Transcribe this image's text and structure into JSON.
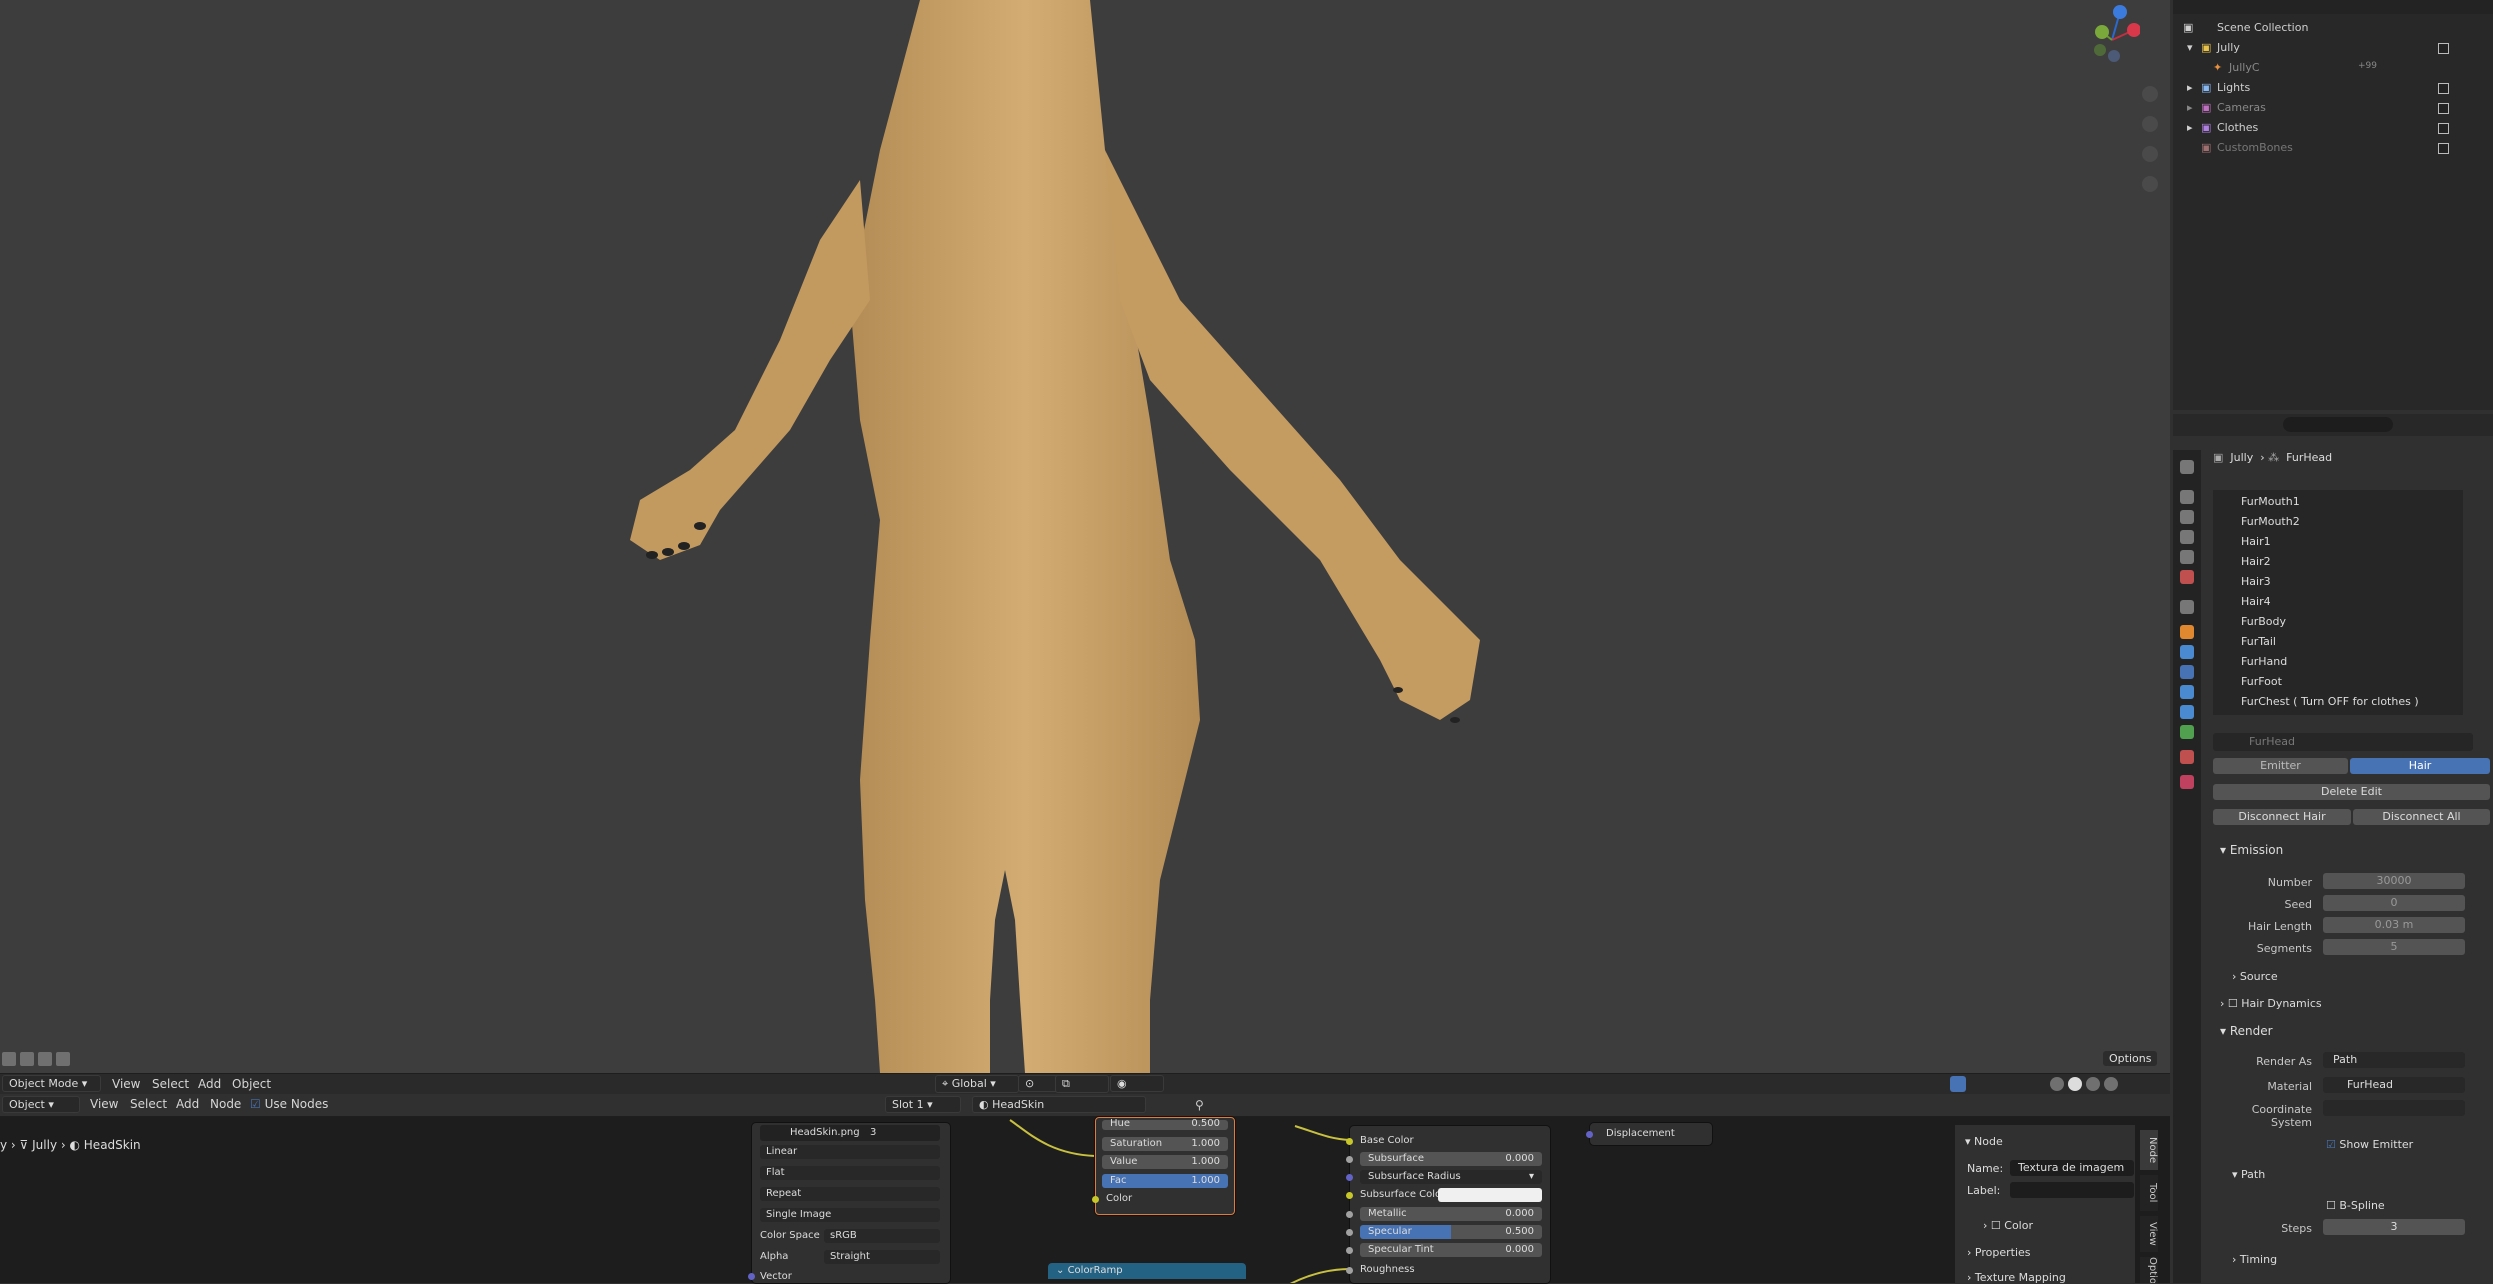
{
  "viewport": {
    "header": {
      "mode": "Object Mode",
      "menus": [
        "View",
        "Select",
        "Add",
        "Object"
      ],
      "orientation": "Global",
      "options": "Options"
    },
    "gizmo": {
      "axis_x": "X",
      "axis_y": "Y",
      "axis_z": "Z"
    }
  },
  "outliner": {
    "title": "Scene Collection",
    "items": [
      {
        "name": "Jully"
      },
      {
        "name": "JullyC",
        "badge": "+99"
      },
      {
        "name": "Lights"
      },
      {
        "name": "Cameras"
      },
      {
        "name": "Clothes"
      },
      {
        "name": "CustomBones"
      }
    ]
  },
  "properties": {
    "breadcrumb": {
      "object": "Jully",
      "system": "FurHead"
    },
    "particle_systems": [
      "FurMouth1",
      "FurMouth2",
      "Hair1",
      "Hair2",
      "Hair3",
      "Hair4",
      "FurBody",
      "FurTail",
      "FurHand",
      "FurFoot",
      "FurChest ( Turn OFF for clothes )"
    ],
    "settings_name": "FurHead",
    "type_tabs": {
      "emitter": "Emitter",
      "hair": "Hair"
    },
    "delete_edit": "Delete Edit",
    "disconnect_hair": "Disconnect Hair",
    "disconnect_all": "Disconnect All",
    "emission": {
      "title": "Emission",
      "number_label": "Number",
      "number": "30000",
      "seed_label": "Seed",
      "seed": "0",
      "hair_length_label": "Hair Length",
      "hair_length": "0.03 m",
      "segments_label": "Segments",
      "segments": "5"
    },
    "source": "Source",
    "hair_dynamics": "Hair Dynamics",
    "render": {
      "title": "Render",
      "render_as_label": "Render As",
      "render_as": "Path",
      "material_label": "Material",
      "material": "FurHead",
      "coord_label": "Coordinate System",
      "show_emitter": "Show Emitter",
      "path": "Path",
      "bspline": "B-Spline",
      "steps_label": "Steps",
      "steps": "3",
      "timing": "Timing"
    }
  },
  "node_editor": {
    "header": {
      "object": "Object",
      "menus": [
        "View",
        "Select",
        "Add",
        "Node"
      ],
      "use_nodes": "Use Nodes",
      "slot": "Slot 1",
      "material": "HeadSkin"
    },
    "breadcrumb": {
      "prefix": "y",
      "object": "Jully",
      "material": "HeadSkin"
    },
    "image_node": {
      "image": "HeadSkin.png",
      "users": "3",
      "interpolation": "Linear",
      "projection": "Flat",
      "extension": "Repeat",
      "source": "Single Image",
      "color_space_label": "Color Space",
      "color_space": "sRGB",
      "alpha_label": "Alpha",
      "alpha": "Straight",
      "vector": "Vector"
    },
    "hsv_node": {
      "hue_label": "Hue",
      "hue": "0.500",
      "saturation_label": "Saturation",
      "saturation": "1.000",
      "value_label": "Value",
      "value": "1.000",
      "fac_label": "Fac",
      "fac": "1.000",
      "color": "Color"
    },
    "bsdf_node": {
      "base_color": "Base Color",
      "subsurface_label": "Subsurface",
      "subsurface": "0.000",
      "subsurface_radius": "Subsurface Radius",
      "subsurface_color": "Subsurface Color",
      "metallic_label": "Metallic",
      "metallic": "0.000",
      "specular_label": "Specular",
      "specular": "0.500",
      "specular_tint_label": "Specular Tint",
      "specular_tint": "0.000",
      "roughness": "Roughness"
    },
    "output_node": {
      "displacement": "Displacement"
    },
    "colorramp": "ColorRamp",
    "sidebar": {
      "panel": "Node",
      "name_label": "Name:",
      "name": "Textura de imagem",
      "label_label": "Label:",
      "color": "Color",
      "properties": "Properties",
      "texture_mapping": "Texture Mapping"
    },
    "vtabs": {
      "node": "Node",
      "tool": "Tool",
      "view": "View",
      "options": "Options"
    }
  },
  "colors": {
    "accent_blue": "#4772b3",
    "fur": "#c9a46a",
    "bg": "#3d3d3d"
  }
}
